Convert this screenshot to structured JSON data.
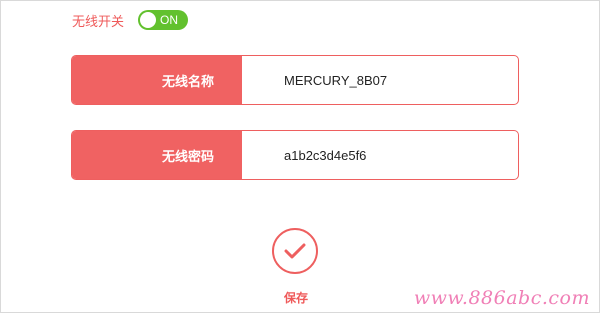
{
  "wireless": {
    "switch_label": "无线开关",
    "switch_state": "ON"
  },
  "fields": {
    "ssid_label": "无线名称",
    "ssid_value": "MERCURY_8B07",
    "password_label": "无线密码",
    "password_value": "a1b2c3d4e5f6"
  },
  "actions": {
    "save_label": "保存"
  },
  "watermark": "www.886abc.com",
  "colors": {
    "accent": "#f06262",
    "toggle_on": "#62c12e"
  }
}
